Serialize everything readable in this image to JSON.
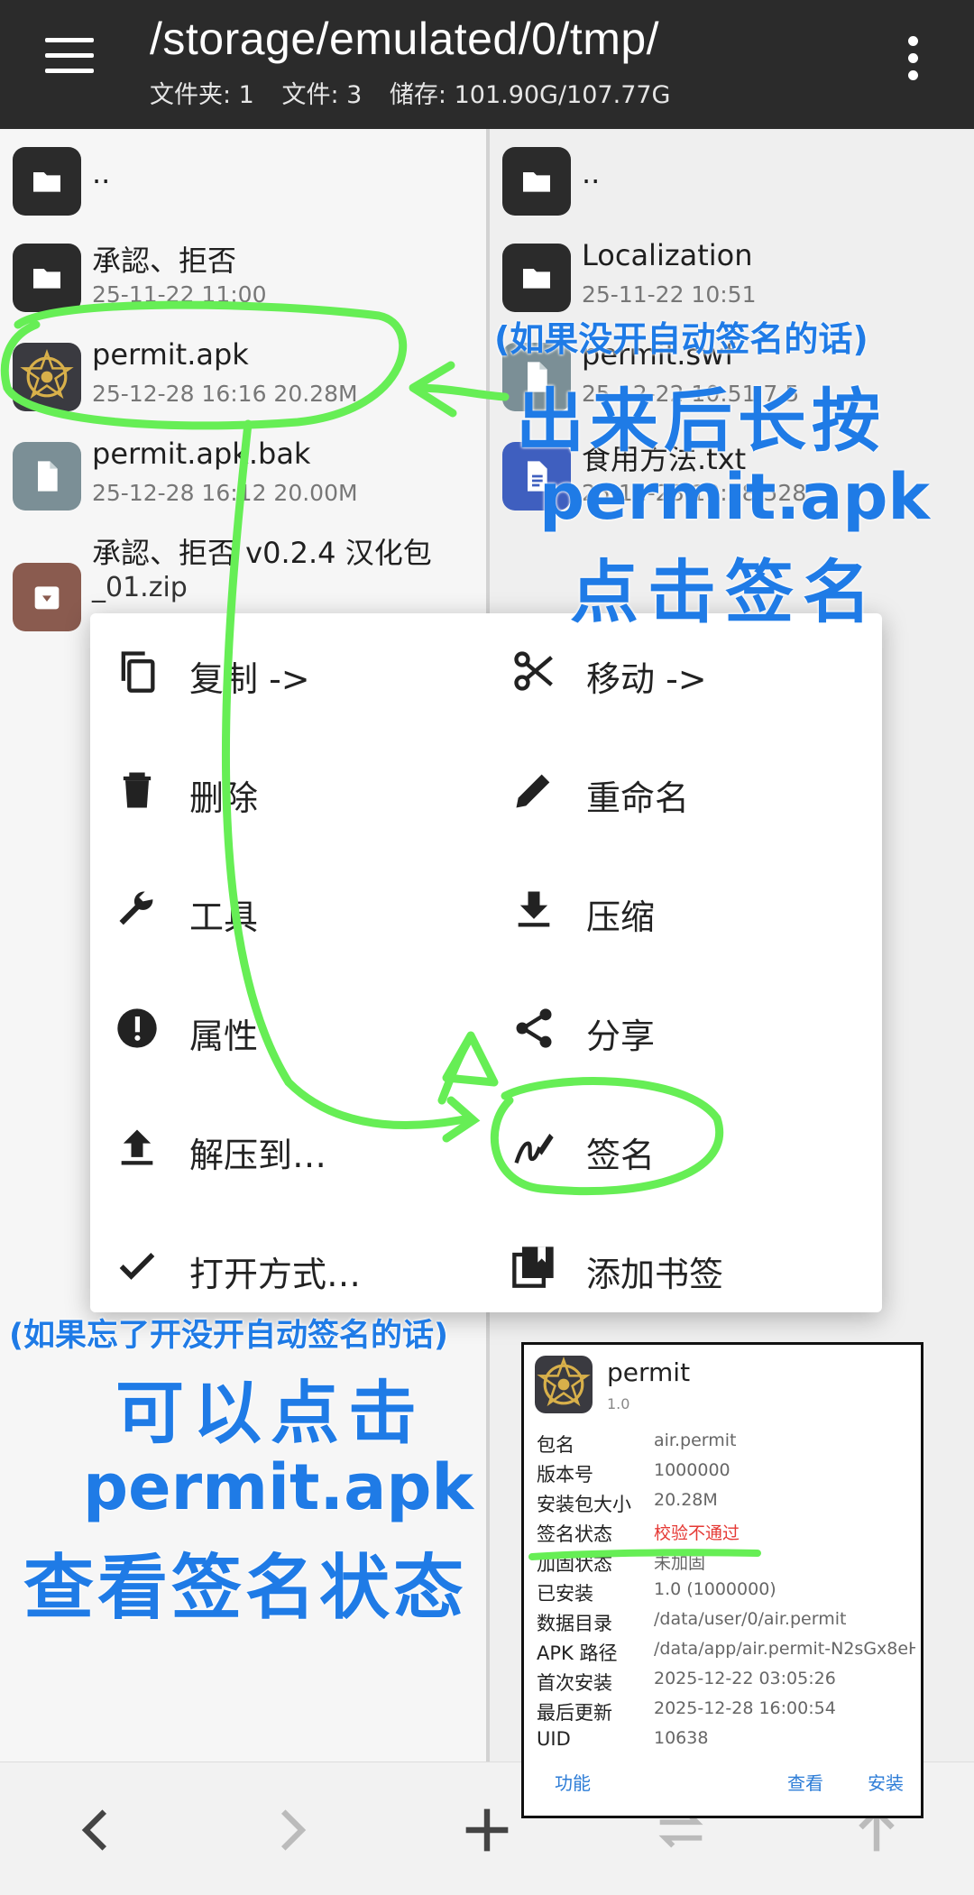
{
  "header": {
    "path": "/storage/emulated/0/tmp/",
    "stats": [
      "文件夹: 1",
      "文件: 3",
      "储存: 101.90G/107.77G"
    ]
  },
  "left_pane": {
    "files": [
      {
        "name": "..",
        "meta": "",
        "icon": "folder-icon",
        "color": "#2b2b2b"
      },
      {
        "name": "承認、拒否",
        "meta": "25-11-22 11:00",
        "icon": "folder-icon",
        "color": "#2b2b2b"
      },
      {
        "name": "permit.apk",
        "meta": "25-12-28 16:16  20.28M",
        "icon": "app-icon",
        "color": "#3a3a40"
      },
      {
        "name": "permit.apk.bak",
        "meta": "25-12-28 16:12  20.00M",
        "icon": "file-icon",
        "color": "#7b8f96"
      },
      {
        "name": "承認、拒否 v0.2.4 汉化包",
        "meta": "_01.zip",
        "icon": "archive-icon",
        "color": "#8a5b4f"
      }
    ]
  },
  "right_pane": {
    "files": [
      {
        "name": "..",
        "meta": "",
        "icon": "folder-icon",
        "color": "#2b2b2b"
      },
      {
        "name": "Localization",
        "meta": "25-11-22 10:51",
        "icon": "folder-icon",
        "color": "#2b2b2b"
      },
      {
        "name": "permit.swf",
        "meta": "25-12-22 10:51  7.5",
        "icon": "file-icon",
        "color": "#7b8f96"
      },
      {
        "name": "食用方法.txt",
        "meta": "25-12-28 10:58  528",
        "icon": "text-file-icon",
        "color": "#3f5fbf"
      }
    ]
  },
  "context_menu": {
    "items": [
      {
        "label": "复制 ->",
        "icon": "copy-icon"
      },
      {
        "label": "移动 ->",
        "icon": "cut-icon"
      },
      {
        "label": "删除",
        "icon": "delete-icon"
      },
      {
        "label": "重命名",
        "icon": "edit-icon"
      },
      {
        "label": "工具",
        "icon": "wrench-icon"
      },
      {
        "label": "压缩",
        "icon": "download-icon"
      },
      {
        "label": "属性",
        "icon": "info-icon"
      },
      {
        "label": "分享",
        "icon": "share-icon"
      },
      {
        "label": "解压到…",
        "icon": "upload-icon"
      },
      {
        "label": "签名",
        "icon": "signature-icon"
      },
      {
        "label": "打开方式…",
        "icon": "check-icon"
      },
      {
        "label": "添加书签",
        "icon": "bookmark-icon"
      }
    ]
  },
  "app_info": {
    "name": "permit",
    "version": "1.0",
    "rows": [
      {
        "key": "包名",
        "value": "air.permit"
      },
      {
        "key": "版本号",
        "value": "1000000"
      },
      {
        "key": "安装包大小",
        "value": "20.28M"
      },
      {
        "key": "签名状态",
        "value": "校验不通过"
      },
      {
        "key": "加固状态",
        "value": "未加固"
      },
      {
        "key": "已安装",
        "value": "1.0 (1000000)"
      },
      {
        "key": "数据目录",
        "value": "/data/user/0/air.permit"
      },
      {
        "key": "APK 路径",
        "value": "/data/app/air.permit-N2sGx8eH…"
      },
      {
        "key": "首次安装",
        "value": "2025-12-22 03:05:26"
      },
      {
        "key": "最后更新",
        "value": "2025-12-28 16:00:54"
      },
      {
        "key": "UID",
        "value": "10638"
      }
    ],
    "actions": {
      "left": "功能",
      "mid": "查看",
      "right": "安装"
    },
    "error_color": "#e53935"
  },
  "annotations": {
    "top_note": "(如果没开自动签名的话)",
    "top_line1": "出来后长按",
    "top_line2": "permit.apk",
    "top_line3": "点击签名",
    "bottom_note": "(如果忘了开没开自动签名的话)",
    "bottom_line1": "可以点击",
    "bottom_line2": "permit.apk",
    "bottom_line3": "查看签名状态",
    "color": "#1f7be6",
    "highlight_color": "#66ee55"
  }
}
